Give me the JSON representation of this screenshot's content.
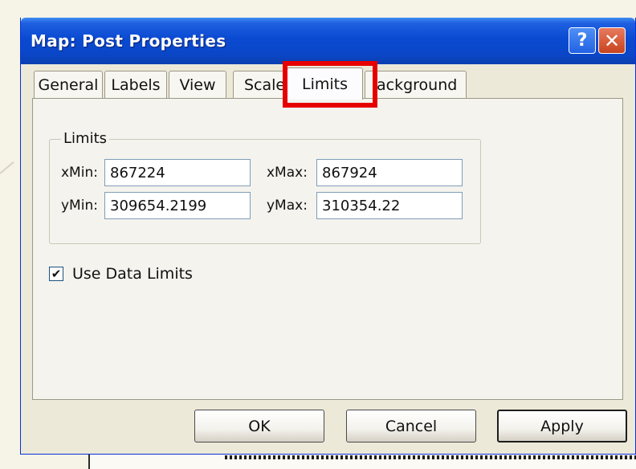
{
  "window": {
    "title": "Map: Post Properties"
  },
  "titlebar": {
    "help_glyph": "?",
    "close_glyph": "✕"
  },
  "tabs": [
    {
      "label": "General"
    },
    {
      "label": "Labels"
    },
    {
      "label": "View"
    },
    {
      "label": "Scale"
    },
    {
      "label": "Limits",
      "active": true
    },
    {
      "label": "ackground"
    }
  ],
  "limits": {
    "group_label": "Limits",
    "xmin_label": "xMin:",
    "xmin_value": "867224",
    "xmax_label": "xMax:",
    "xmax_value": "867924",
    "ymin_label": "yMin:",
    "ymin_value": "309654.2199",
    "ymax_label": "yMax:",
    "ymax_value": "310354.22"
  },
  "use_data_limits": {
    "label": "Use Data Limits",
    "checked": true,
    "check_glyph": "✔"
  },
  "buttons": {
    "ok": "OK",
    "cancel": "Cancel",
    "apply": "Apply"
  },
  "colors": {
    "title_bar": "#0a46c6",
    "dialog_face": "#ece9d8",
    "highlight": "#e60000",
    "close_button": "#c8431f"
  },
  "icons": {
    "help": "help-icon",
    "close": "close-icon",
    "check": "checkmark-icon"
  }
}
